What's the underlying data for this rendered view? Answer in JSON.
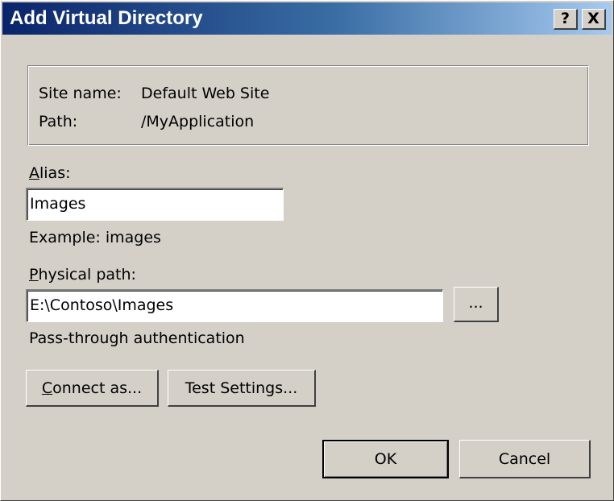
{
  "window": {
    "title": "Add Virtual Directory",
    "help_label": "?",
    "close_label": "X"
  },
  "info": {
    "site_name_label": "Site name:",
    "site_name_value": "Default Web Site",
    "path_label": "Path:",
    "path_value": "/MyApplication"
  },
  "alias": {
    "label_mnemonic": "A",
    "label_rest": "lias:",
    "value": "Images",
    "example": "Example: images"
  },
  "physical_path": {
    "label_mnemonic": "P",
    "label_rest": "hysical path:",
    "value": "E:\\Contoso\\Images",
    "browse_label": "..."
  },
  "auth": {
    "text": "Pass-through authentication"
  },
  "buttons": {
    "connect_as_mnemonic": "C",
    "connect_as_rest": "onnect as...",
    "test_settings_label": "Test Settings...",
    "ok_label": "OK",
    "cancel_label": "Cancel"
  }
}
